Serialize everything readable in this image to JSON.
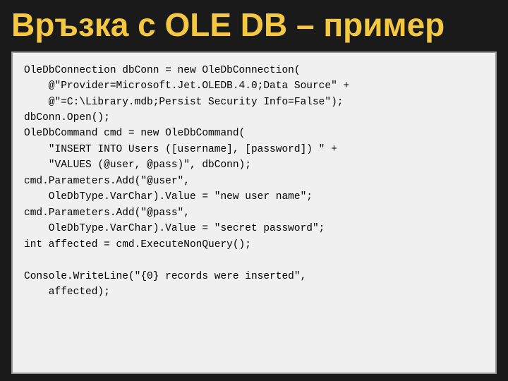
{
  "title": "Връзка с OLE DB – пример",
  "colors": {
    "title": "#f5c842",
    "background": "#1a1a1a",
    "codeBg": "#f0f0f0"
  },
  "code": {
    "lines": [
      "OleDbConnection dbConn = new OleDbConnection(",
      "    @\"Provider=Microsoft.Jet.OLEDB.4.0;Data Source\" +",
      "    @\"=C:\\Library.mdb;Persist Security Info=False\");",
      "dbConn.Open();",
      "OleDbCommand cmd = new OleDbCommand(",
      "    \"INSERT INTO Users ([username], [password]) \" +",
      "    \"VALUES (@user, @pass)\", dbConn);",
      "cmd.Parameters.Add(\"@user\",",
      "    OleDbType.VarChar).Value = \"new user name\";",
      "cmd.Parameters.Add(\"@pass\",",
      "    OleDbType.VarChar).Value = \"secret password\";",
      "int affected = cmd.ExecuteNonQuery();",
      "",
      "Console.WriteLine(\"{0} records were inserted\",",
      "    affected);"
    ]
  }
}
